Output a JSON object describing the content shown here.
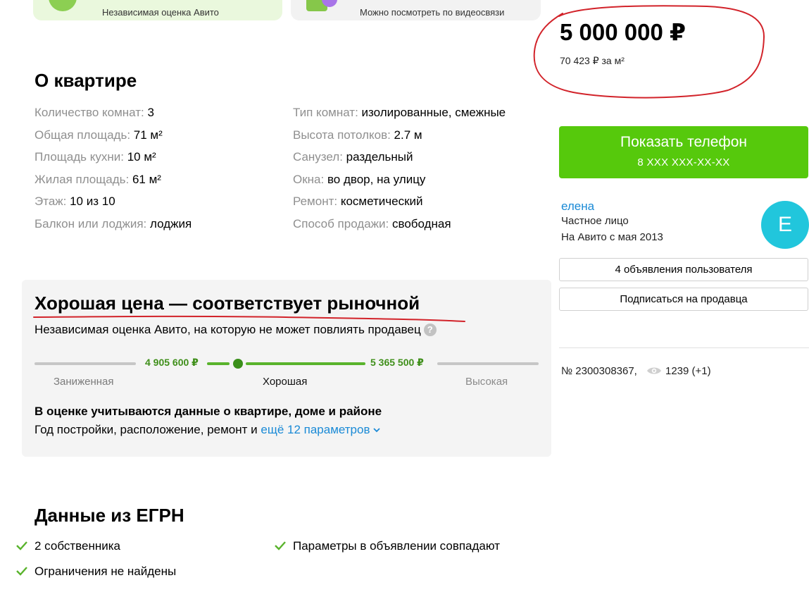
{
  "promos": [
    {
      "text": "Независимая оценка Авито",
      "icon": "shield-check-icon"
    },
    {
      "text": "Можно посмотреть по видеосвязи",
      "icon": "video-call-icon"
    }
  ],
  "about": {
    "title": "О квартире",
    "left": [
      {
        "key": "Количество комнат: ",
        "value": "3"
      },
      {
        "key": "Общая площадь: ",
        "value": "71 м²"
      },
      {
        "key": "Площадь кухни: ",
        "value": "10 м²"
      },
      {
        "key": "Жилая площадь: ",
        "value": "61 м²"
      },
      {
        "key": "Этаж: ",
        "value": "10 из 10"
      },
      {
        "key": "Балкон или лоджия: ",
        "value": "лоджия"
      }
    ],
    "right": [
      {
        "key": "Тип комнат: ",
        "value": "изолированные, смежные"
      },
      {
        "key": "Высота потолков: ",
        "value": "2.7 м"
      },
      {
        "key": "Санузел: ",
        "value": "раздельный"
      },
      {
        "key": "Окна: ",
        "value": "во двор, на улицу"
      },
      {
        "key": "Ремонт: ",
        "value": "косметический"
      },
      {
        "key": "Способ продажи: ",
        "value": "свободная"
      }
    ]
  },
  "assessment": {
    "title": "Хорошая цена — соответствует рыночной",
    "subtitle": "Независимая оценка Авито, на которую не может повлиять продавец",
    "help_icon": "question-icon",
    "range_low": "4 905 600 ₽",
    "range_high": "5 365 500 ₽",
    "labels": [
      "Заниженная",
      "Хорошая",
      "Высокая"
    ],
    "note_title": "В оценке учитываются данные о квартире, доме и районе",
    "note_text": "Год постройки, расположение, ремонт и ",
    "note_link": "ещё 12 параметров",
    "note_link_icon": "chevron-down-icon"
  },
  "egrn": {
    "title": "Данные из ЕГРН",
    "items": [
      "2 собственника",
      "Параметры в объявлении совпадают",
      "Ограничения не найдены"
    ]
  },
  "sidebar": {
    "price": "5 000 000 ₽",
    "price_per_m2": "70 423 ₽ за м²",
    "phone_button": "Показать телефон",
    "phone_masked": "8 XXX XXX-XX-XX",
    "seller_name": "елена",
    "seller_type": "Частное лицо",
    "seller_since": "На Авито с мая 2013",
    "avatar_letter": "Е",
    "listings_button": "4 объявления пользователя",
    "subscribe_button": "Подписаться на продавца",
    "ad_number": "№ 2300308367,",
    "views": "1239 (+1)",
    "views_icon": "eye-icon"
  },
  "colors": {
    "accent_green": "#56c90c",
    "link_blue": "#1a8ad6",
    "avatar": "#21c6dc",
    "annotation_red": "#d2232a"
  }
}
